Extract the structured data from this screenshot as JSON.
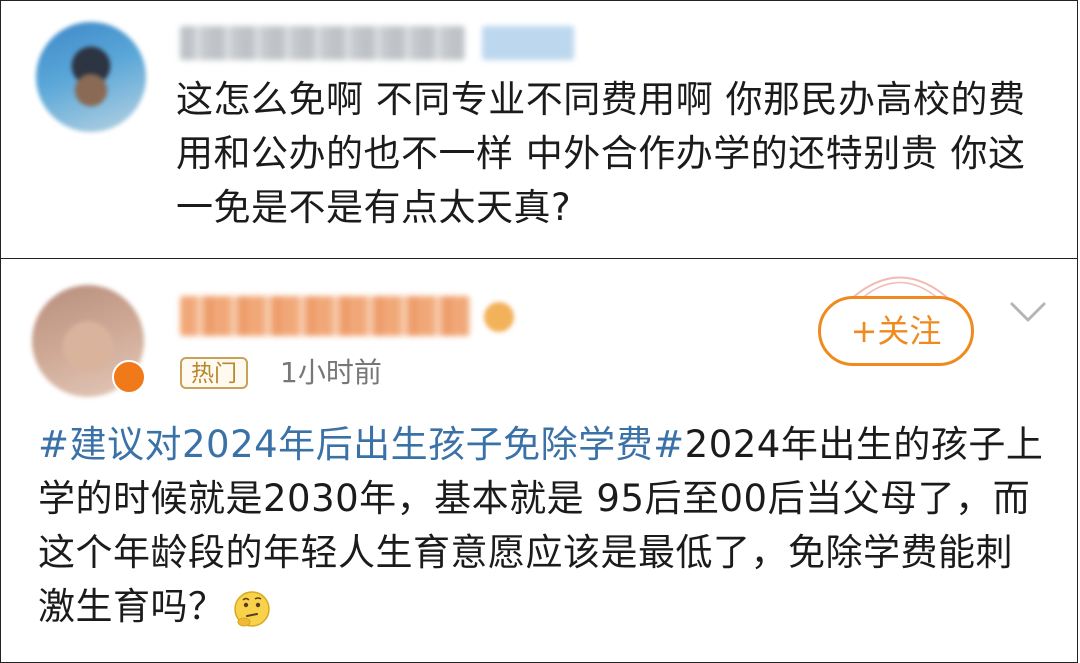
{
  "comment1": {
    "text": "这怎么免啊 不同专业不同费用啊 你那民办高校的费用和公办的也不一样 中外合作办学的还特别贵 你这一免是不是有点太天真?"
  },
  "post2": {
    "hot_badge": "热门",
    "time": "1小时前",
    "follow_label": "+关注",
    "hashtag": "#建议对2024年后出生孩子免除学费#",
    "body": "2024年出生的孩子上学的时候就是2030年，基本就是 95后至00后当父母了，而这个年龄段的年轻人生育意愿应该是最低了，免除学费能刺激生育吗？"
  },
  "colors": {
    "hashtag": "#3a72a8",
    "follow": "#f08a1e",
    "hot_badge": "#c8a15a"
  }
}
